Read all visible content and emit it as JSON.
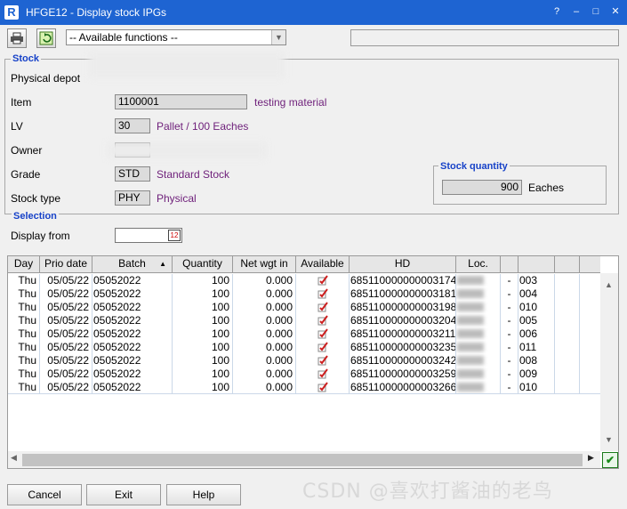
{
  "window": {
    "logo": "R",
    "title": "HFGE12 - Display stock IPGs",
    "controls": [
      "?",
      "–",
      "□",
      "✕"
    ]
  },
  "toolbar": {
    "functions_placeholder": "-- Available functions --"
  },
  "stock": {
    "title": "Stock",
    "physical_depot_label": "Physical depot",
    "item_label": "Item",
    "item_value": "1100001",
    "item_desc": "testing material",
    "lv_label": "LV",
    "lv_value": "30",
    "lv_desc": "Pallet / 100 Eaches",
    "owner_label": "Owner",
    "grade_label": "Grade",
    "grade_value": "STD",
    "grade_desc": "Standard Stock",
    "stock_type_label": "Stock type",
    "stock_type_value": "PHY",
    "stock_type_desc": "Physical"
  },
  "stock_quantity": {
    "title": "Stock quantity",
    "value": "900",
    "unit": "Eaches"
  },
  "selection": {
    "title": "Selection",
    "display_from_label": "Display from"
  },
  "grid": {
    "columns": [
      "Day",
      "Prio date",
      "Batch",
      "Quantity",
      "Net wgt in",
      "Available",
      "HD",
      "Loc.",
      "",
      "",
      ""
    ],
    "sort_indicator": "▲",
    "rows": [
      {
        "day": "Thu",
        "prio_date": "05/05/22",
        "batch": "05052022",
        "quantity": "100",
        "net_wgt": "0.000",
        "hd": "685110000000003174",
        "loc": "",
        "sep": "-",
        "code": "003"
      },
      {
        "day": "Thu",
        "prio_date": "05/05/22",
        "batch": "05052022",
        "quantity": "100",
        "net_wgt": "0.000",
        "hd": "685110000000003181",
        "loc": "",
        "sep": "-",
        "code": "004"
      },
      {
        "day": "Thu",
        "prio_date": "05/05/22",
        "batch": "05052022",
        "quantity": "100",
        "net_wgt": "0.000",
        "hd": "685110000000003198",
        "loc": "",
        "sep": "-",
        "code": "010"
      },
      {
        "day": "Thu",
        "prio_date": "05/05/22",
        "batch": "05052022",
        "quantity": "100",
        "net_wgt": "0.000",
        "hd": "685110000000003204",
        "loc": "",
        "sep": "-",
        "code": "005"
      },
      {
        "day": "Thu",
        "prio_date": "05/05/22",
        "batch": "05052022",
        "quantity": "100",
        "net_wgt": "0.000",
        "hd": "685110000000003211",
        "loc": "",
        "sep": "-",
        "code": "006"
      },
      {
        "day": "Thu",
        "prio_date": "05/05/22",
        "batch": "05052022",
        "quantity": "100",
        "net_wgt": "0.000",
        "hd": "685110000000003235",
        "loc": "",
        "sep": "-",
        "code": "011"
      },
      {
        "day": "Thu",
        "prio_date": "05/05/22",
        "batch": "05052022",
        "quantity": "100",
        "net_wgt": "0.000",
        "hd": "685110000000003242",
        "loc": "",
        "sep": "-",
        "code": "008"
      },
      {
        "day": "Thu",
        "prio_date": "05/05/22",
        "batch": "05052022",
        "quantity": "100",
        "net_wgt": "0.000",
        "hd": "685110000000003259",
        "loc": "",
        "sep": "-",
        "code": "009"
      },
      {
        "day": "Thu",
        "prio_date": "05/05/22",
        "batch": "05052022",
        "quantity": "100",
        "net_wgt": "0.000",
        "hd": "685110000000003266",
        "loc": "",
        "sep": "-",
        "code": "010"
      }
    ]
  },
  "buttons": {
    "cancel": "Cancel",
    "exit": "Exit",
    "help": "Help"
  },
  "watermark": "CSDN @喜欢打酱油的老鸟",
  "colors": {
    "titlebar": "#1e64d2",
    "group_title": "#1742c8",
    "description": "#6e1f7a",
    "check": "#cc1f1f"
  }
}
